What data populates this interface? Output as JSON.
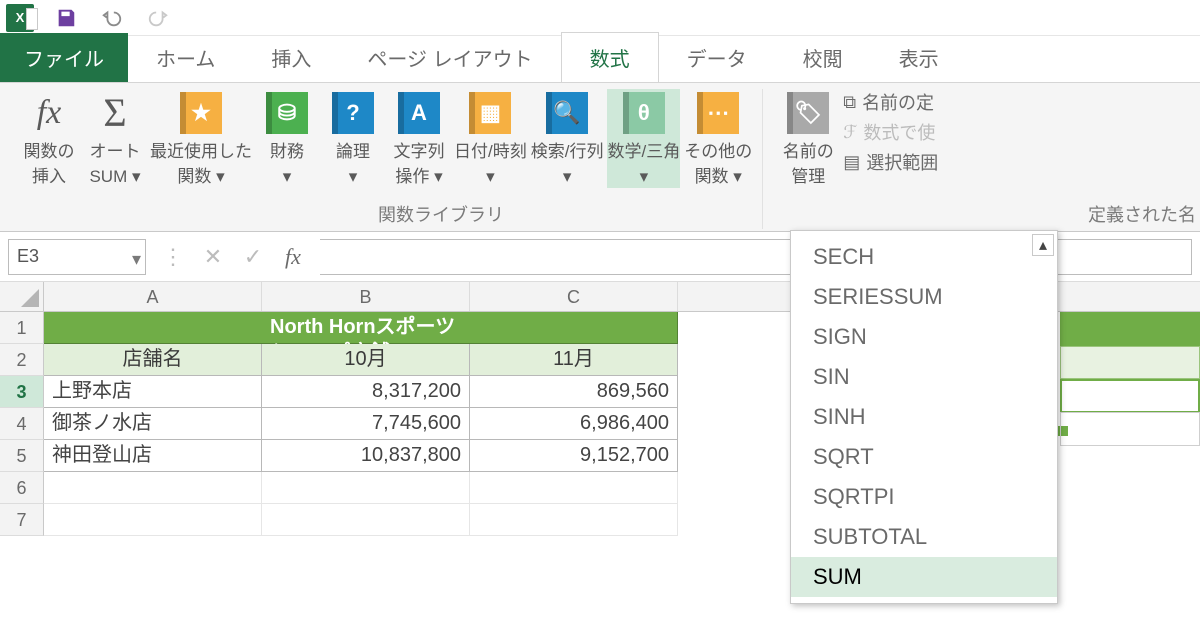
{
  "tabs": {
    "file": "ファイル",
    "home": "ホーム",
    "insert": "挿入",
    "pageLayout": "ページ レイアウト",
    "formulas": "数式",
    "data": "データ",
    "review": "校閲",
    "view": "表示"
  },
  "ribbon": {
    "insertFunction_l1": "関数の",
    "insertFunction_l2": "挿入",
    "autoSum_l1": "オート",
    "autoSum_l2": "SUM ▾",
    "recent_l1": "最近使用した",
    "recent_l2": "関数 ▾",
    "financial": "財務",
    "logical": "論理",
    "text_l1": "文字列",
    "text_l2": "操作 ▾",
    "dateTime": "日付/時刻",
    "lookup": "検索/行列",
    "mathTrig": "数学/三角",
    "more_l1": "その他の",
    "more_l2": "関数 ▾",
    "nameMgr_l1": "名前の",
    "nameMgr_l2": "管理",
    "defineName": "名前の定",
    "useInFormula": "数式で使",
    "createFromSel": "選択範囲",
    "groupLibrary": "関数ライブラリ",
    "groupDefined": "定義された名",
    "dropdownMark": "▾"
  },
  "nameBox": "E3",
  "cols": {
    "A": "A",
    "B": "B",
    "C": "C"
  },
  "rows": [
    "1",
    "2",
    "3",
    "4",
    "5",
    "6",
    "7"
  ],
  "sheet": {
    "title": "North Hornスポーツショップ店舗",
    "headers": {
      "name": "店舗名",
      "oct": "10月",
      "nov": "11月"
    },
    "data": [
      {
        "name": "上野本店",
        "oct": "8,317,200",
        "nov": "869,560"
      },
      {
        "name": "御茶ノ水店",
        "oct": "7,745,600",
        "nov": "6,986,400"
      },
      {
        "name": "神田登山店",
        "oct": "10,837,800",
        "nov": "9,152,700"
      }
    ]
  },
  "funcList": [
    "SECH",
    "SERIESSUM",
    "SIGN",
    "SIN",
    "SINH",
    "SQRT",
    "SQRTPI",
    "SUBTOTAL",
    "SUM"
  ],
  "colors": {
    "star": "#F6B042",
    "fin": "#4CB050",
    "logic": "#1E88C7",
    "text": "#1E88C7",
    "date": "#F6B042",
    "lookup": "#1E88C7",
    "math": "#8BC9A5",
    "more": "#F6B042",
    "mgr": "#A9A9A9"
  },
  "chart_data": {
    "type": "table",
    "title": "North Hornスポーツショップ店舗",
    "columns": [
      "店舗名",
      "10月",
      "11月"
    ],
    "rows": [
      [
        "上野本店",
        8317200,
        869560
      ],
      [
        "御茶ノ水店",
        7745600,
        6986400
      ],
      [
        "神田登山店",
        10837800,
        9152700
      ]
    ]
  }
}
